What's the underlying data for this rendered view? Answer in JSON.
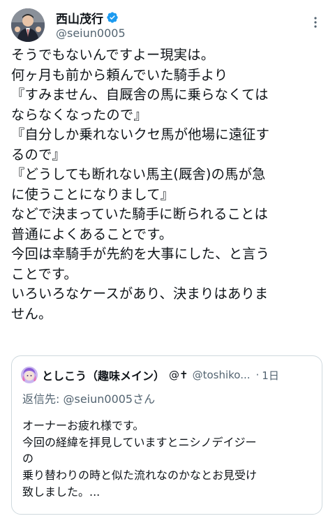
{
  "author": {
    "display_name": "西山茂行",
    "handle": "@seiun0005"
  },
  "tweet": {
    "lines": [
      "そうでもないんですよー現実は。",
      "何ヶ月も前から頼んでいた騎手より",
      "『すみません、自厩舎の馬に乗らなくては",
      "ならなくなったので』",
      "『自分しか乗れないクセ馬が他場に遠征す",
      "るので』",
      "『どうしても断れない馬主(厩舎)の馬が急",
      "に使うことになりまして』",
      "などで決まっていた騎手に断られることは",
      "普通によくあることです。",
      "今回は幸騎手が先約を大事にした、と言う",
      "ことです。",
      "いろいろなケースがあり、決まりはありま",
      "せん。"
    ]
  },
  "quoted": {
    "display_name": "としこう（趣味メイン）",
    "badge": "@✝",
    "handle": "@toshiko...",
    "separator": "·",
    "time": "1日",
    "reply_to": "返信先: @seiun0005さん",
    "lines": [
      "オーナーお疲れ様です。",
      "今回の経緯を拝見していますとニシノデイジー",
      "の",
      "乗り替わりの時と似た流れなのかなとお見受け",
      "致しました。..."
    ]
  },
  "icons": {
    "verified": "verified-badge-icon",
    "more": "more-options-icon"
  },
  "colors": {
    "text": "#0f1419",
    "secondary": "#536471",
    "verified": "#1d9bf0",
    "border": "#cfd9de"
  }
}
